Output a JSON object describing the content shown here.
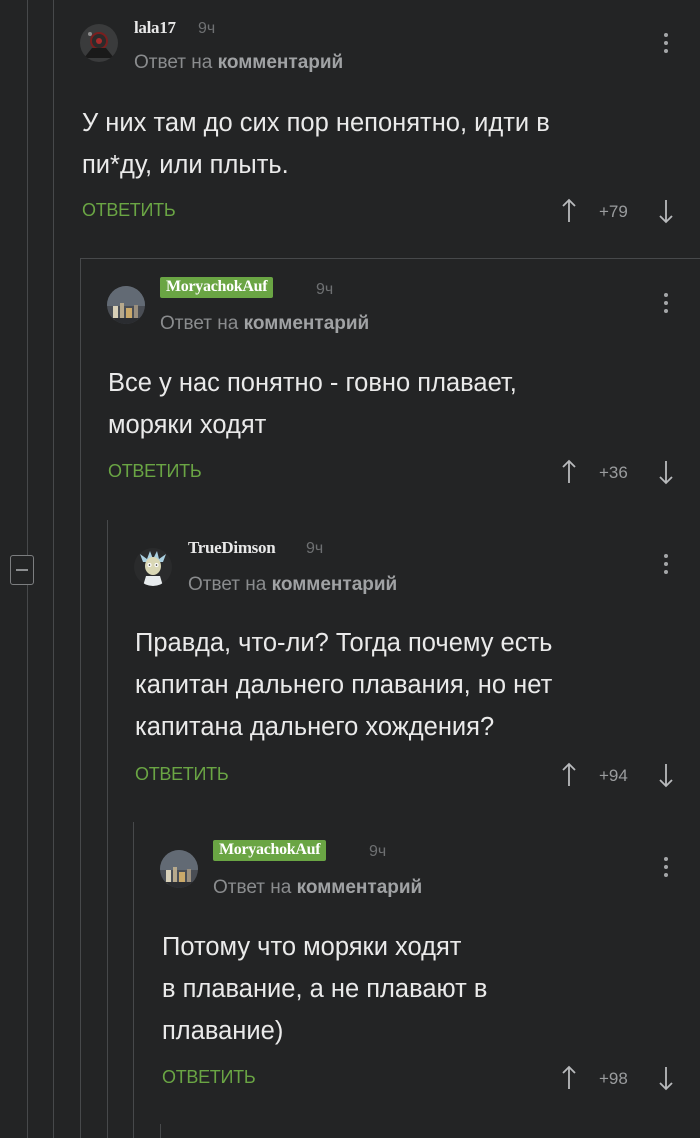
{
  "comments": [
    {
      "username": "lala17",
      "time": "9ч",
      "reply_prefix": "Ответ на",
      "reply_link": "комментарий",
      "lines": [
        "У них там до сих пор непонятно, идти в",
        "пи*ду, или плыть."
      ],
      "reply_label": "ОТВЕТИТЬ",
      "score": "+79",
      "avatar_icon": "dark-red-avatar"
    },
    {
      "username": "MoryachokAuf",
      "time": "9ч",
      "reply_prefix": "Ответ на",
      "reply_link": "комментарий",
      "lines": [
        "Все у нас понятно - говно плавает,",
        "моряки ходят"
      ],
      "reply_label": "ОТВЕТИТЬ",
      "score": "+36",
      "avatar_icon": "night-city-avatar"
    },
    {
      "username": "TrueDimson",
      "time": "9ч",
      "reply_prefix": "Ответ на",
      "reply_link": "комментарий",
      "lines": [
        "Правда, что-ли? Тогда почему есть",
        "капитан дальнего плавания, но нет",
        "капитана дальнего хождения?"
      ],
      "reply_label": "ОТВЕТИТЬ",
      "score": "+94",
      "avatar_icon": "cartoon-scientist-avatar"
    },
    {
      "username": "MoryachokAuf",
      "time": "9ч",
      "reply_prefix": "Ответ на",
      "reply_link": "комментарий",
      "lines": [
        "Потому что моряки ходят",
        "в плавание, а не плавают в",
        "плавание)"
      ],
      "reply_label": "ОТВЕТИТЬ",
      "score": "+98",
      "avatar_icon": "night-city-avatar"
    }
  ],
  "colors": {
    "background": "#232425",
    "accent_green": "#6aa544",
    "text": "#eaeaea",
    "muted": "#8a8c8e"
  }
}
